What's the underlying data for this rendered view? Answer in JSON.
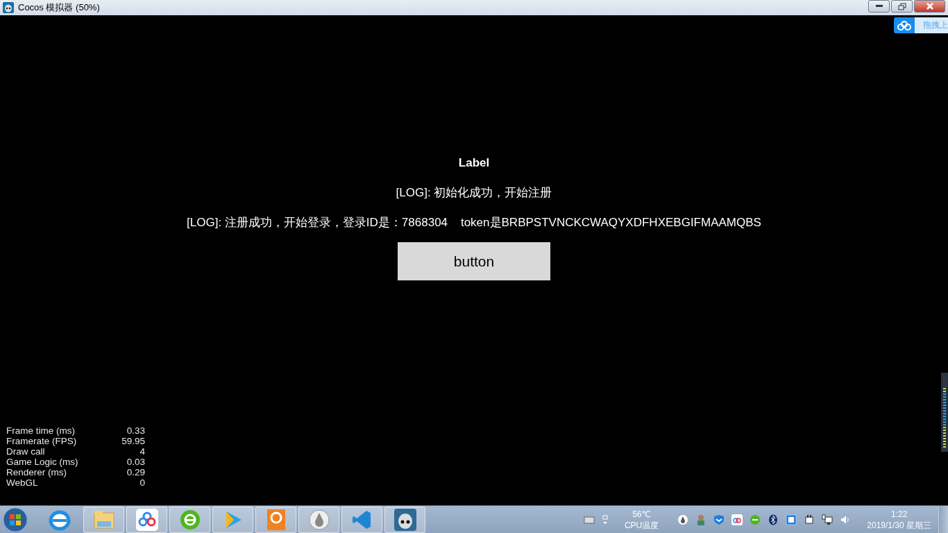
{
  "window": {
    "title": "Cocos 模拟器 (50%)"
  },
  "upload_widget": {
    "text": "拖拽上"
  },
  "scene": {
    "title": "Label",
    "logs": [
      "[LOG]: 初始化成功，开始注册",
      "[LOG]: 注册成功，开始登录，登录ID是：7868304    token是BRBPSTVNCKCWAQYXDFHXEBGIFMAAMQBS"
    ],
    "button": "button"
  },
  "stats": [
    {
      "label": "Frame time (ms)",
      "value": "0.33"
    },
    {
      "label": "Framerate (FPS)",
      "value": "59.95"
    },
    {
      "label": "Draw call",
      "value": "4"
    },
    {
      "label": "Game Logic (ms)",
      "value": "0.03"
    },
    {
      "label": "Renderer (ms)",
      "value": "0.29"
    },
    {
      "label": "WebGL",
      "value": "0"
    }
  ],
  "taskbar": {
    "temperature": "56℃",
    "temperature_label": "CPU温度",
    "time": "1:22",
    "date": "2019/1/30 星期三"
  }
}
